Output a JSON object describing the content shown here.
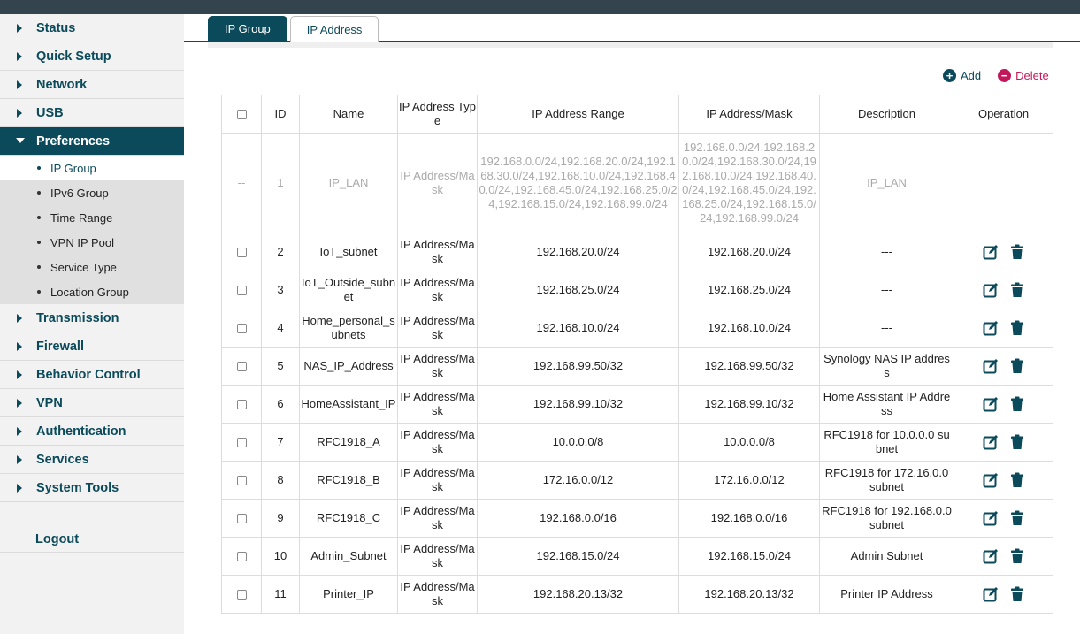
{
  "colors": {
    "primary": "#0b4a5a",
    "delete": "#c2185b",
    "topbar": "#34444c"
  },
  "sidebar": {
    "items": [
      {
        "label": "Status"
      },
      {
        "label": "Quick Setup"
      },
      {
        "label": "Network"
      },
      {
        "label": "USB"
      },
      {
        "label": "Preferences"
      },
      {
        "label": "Transmission"
      },
      {
        "label": "Firewall"
      },
      {
        "label": "Behavior Control"
      },
      {
        "label": "VPN"
      },
      {
        "label": "Authentication"
      },
      {
        "label": "Services"
      },
      {
        "label": "System Tools"
      }
    ],
    "subitems": [
      {
        "label": "IP Group"
      },
      {
        "label": "IPv6 Group"
      },
      {
        "label": "Time Range"
      },
      {
        "label": "VPN IP Pool"
      },
      {
        "label": "Service Type"
      },
      {
        "label": "Location Group"
      }
    ],
    "logout": "Logout"
  },
  "tabs": [
    {
      "label": "IP Group"
    },
    {
      "label": "IP Address"
    }
  ],
  "toolbar": {
    "add_label": "Add",
    "delete_label": "Delete",
    "add_icon": "plus-circle-icon",
    "delete_icon": "minus-circle-icon"
  },
  "table": {
    "headers": [
      "ID",
      "Name",
      "IP Address Type",
      "IP Address Range",
      "IP Address/Mask",
      "Description",
      "Operation"
    ],
    "rows": [
      {
        "check": "--",
        "id": "1",
        "name": "IP_LAN",
        "type": "IP Address/Mask",
        "range": "192.168.0.0/24,192.168.20.0/24,192.168.30.0/24,192.168.10.0/24,192.168.40.0/24,192.168.45.0/24,192.168.25.0/24,192.168.15.0/24,192.168.99.0/24",
        "mask": "192.168.0.0/24,192.168.20.0/24,192.168.30.0/24,192.168.10.0/24,192.168.40.0/24,192.168.45.0/24,192.168.25.0/24,192.168.15.0/24,192.168.99.0/24",
        "desc": "IP_LAN"
      },
      {
        "id": "2",
        "name": "IoT_subnet",
        "type": "IP Address/Mask",
        "range": "192.168.20.0/24",
        "mask": "192.168.20.0/24",
        "desc": "---"
      },
      {
        "id": "3",
        "name": "IoT_Outside_subnet",
        "type": "IP Address/Mask",
        "range": "192.168.25.0/24",
        "mask": "192.168.25.0/24",
        "desc": "---"
      },
      {
        "id": "4",
        "name": "Home_personal_subnets",
        "type": "IP Address/Mask",
        "range": "192.168.10.0/24",
        "mask": "192.168.10.0/24",
        "desc": "---"
      },
      {
        "id": "5",
        "name": "NAS_IP_Address",
        "type": "IP Address/Mask",
        "range": "192.168.99.50/32",
        "mask": "192.168.99.50/32",
        "desc": "Synology NAS IP address"
      },
      {
        "id": "6",
        "name": "HomeAssistant_IP",
        "type": "IP Address/Mask",
        "range": "192.168.99.10/32",
        "mask": "192.168.99.10/32",
        "desc": "Home Assistant IP Address"
      },
      {
        "id": "7",
        "name": "RFC1918_A",
        "type": "IP Address/Mask",
        "range": "10.0.0.0/8",
        "mask": "10.0.0.0/8",
        "desc": "RFC1918 for 10.0.0.0 subnet"
      },
      {
        "id": "8",
        "name": "RFC1918_B",
        "type": "IP Address/Mask",
        "range": "172.16.0.0/12",
        "mask": "172.16.0.0/12",
        "desc": "RFC1918 for 172.16.0.0 subnet"
      },
      {
        "id": "9",
        "name": "RFC1918_C",
        "type": "IP Address/Mask",
        "range": "192.168.0.0/16",
        "mask": "192.168.0.0/16",
        "desc": "RFC1918 for 192.168.0.0 subnet"
      },
      {
        "id": "10",
        "name": "Admin_Subnet",
        "type": "IP Address/Mask",
        "range": "192.168.15.0/24",
        "mask": "192.168.15.0/24",
        "desc": "Admin Subnet"
      },
      {
        "id": "11",
        "name": "Printer_IP",
        "type": "IP Address/Mask",
        "range": "192.168.20.13/32",
        "mask": "192.168.20.13/32",
        "desc": "Printer IP Address"
      }
    ],
    "op_icons": [
      "edit-icon",
      "trash-icon"
    ]
  }
}
